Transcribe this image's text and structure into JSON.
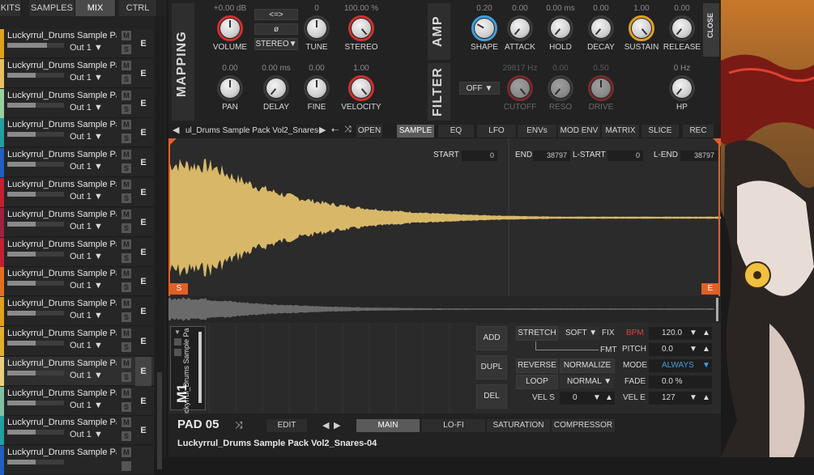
{
  "top_tabs": [
    "KITS",
    "SAMPLES",
    "MIX",
    "CTRL"
  ],
  "active_top_tab": "MIX",
  "pads": [
    {
      "name": "Luckyrrul_Drums Sample Pa...",
      "out": "Out 1 ▼",
      "color": "#e0a020",
      "level": 0.7,
      "mute": "M",
      "solo": "S",
      "edit": "E"
    },
    {
      "name": "Luckyrrul_Drums Sample Pa...",
      "out": "Out 1 ▼",
      "color": "#e8c060",
      "level": 0.5,
      "mute": "M",
      "solo": "S",
      "edit": "E"
    },
    {
      "name": "Luckyrrul_Drums Sample Pa...",
      "out": "Out 1 ▼",
      "color": "#9ad0a0",
      "level": 0.5,
      "mute": "M",
      "solo": "S",
      "edit": "E"
    },
    {
      "name": "Luckyrrul_Drums Sample Pa...",
      "out": "Out 1 ▼",
      "color": "#20a0a0",
      "level": 0.5,
      "mute": "M",
      "solo": "S",
      "edit": "E"
    },
    {
      "name": "Luckyrrul_Drums Sample Pa...",
      "out": "Out 1 ▼",
      "color": "#2060c0",
      "level": 0.5,
      "mute": "M",
      "solo": "S",
      "edit": "E"
    },
    {
      "name": "Luckyrrul_Drums Sample Pa...",
      "out": "Out 1 ▼",
      "color": "#c02030",
      "level": 0.5,
      "mute": "M",
      "solo": "S",
      "edit": "E"
    },
    {
      "name": "Luckyrrul_Drums Sample Pa...",
      "out": "Out 1 ▼",
      "color": "#a02040",
      "level": 0.5,
      "mute": "M",
      "solo": "S",
      "edit": "E"
    },
    {
      "name": "Luckyrrul_Drums Sample Pa...",
      "out": "Out 1 ▼",
      "color": "#c02030",
      "level": 0.5,
      "mute": "M",
      "solo": "S",
      "edit": "E"
    },
    {
      "name": "Luckyrrul_Drums Sample Pa...",
      "out": "Out 1 ▼",
      "color": "#e07020",
      "level": 0.5,
      "mute": "M",
      "solo": "S",
      "edit": "E"
    },
    {
      "name": "Luckyrrul_Drums Sample Pa...",
      "out": "Out 1 ▼",
      "color": "#e0a020",
      "level": 0.5,
      "mute": "M",
      "solo": "S",
      "edit": "E"
    },
    {
      "name": "Luckyrrul_Drums Sample Pa...",
      "out": "Out 1 ▼",
      "color": "#e0b030",
      "level": 0.5,
      "mute": "M",
      "solo": "S",
      "edit": "E"
    },
    {
      "name": "Luckyrrul_Drums Sample Pa...",
      "out": "Out 1 ▼",
      "color": "#e8d080",
      "level": 0.5,
      "mute": "M",
      "solo": "S",
      "edit": "E"
    },
    {
      "name": "Luckyrrul_Drums Sample Pa...",
      "out": "Out 1 ▼",
      "color": "#80c0a0",
      "level": 0.5,
      "mute": "M",
      "solo": "S",
      "edit": "E"
    },
    {
      "name": "Luckyrrul_Drums Sample Pa...",
      "out": "Out 1 ▼",
      "color": "#20a0a0",
      "level": 0.5,
      "mute": "M",
      "solo": "S",
      "edit": "E"
    },
    {
      "name": "Luckyrrul_Drums Sample Pa...",
      "out": "",
      "color": "#2060c0",
      "level": 0.5,
      "mute": "M",
      "solo": "",
      "edit": ""
    }
  ],
  "active_pad_index": 11,
  "mapping": {
    "title": "MAPPING",
    "volume": {
      "label": "VOLUME",
      "value": "+0.00 dB"
    },
    "tune": {
      "label": "TUNE",
      "value": "0"
    },
    "stereo": {
      "label": "STEREO",
      "value": "100.00 %"
    },
    "pan": {
      "label": "PAN",
      "value": "0.00"
    },
    "delay": {
      "label": "DELAY",
      "value": "0.00 ms"
    },
    "fine": {
      "label": "FINE",
      "value": "0.00"
    },
    "velocity": {
      "label": "VELOCITY",
      "value": "1.00"
    },
    "link_btn": "<=>",
    "phase_btn": "ø",
    "stereo_mode": "STEREO▼"
  },
  "amp": {
    "title": "AMP",
    "shape": {
      "label": "SHAPE",
      "value": "0.20"
    },
    "attack": {
      "label": "ATTACK",
      "value": "0.00"
    },
    "hold": {
      "label": "HOLD",
      "value": "0.00 ms"
    },
    "decay": {
      "label": "DECAY",
      "value": "0.00"
    },
    "sustain": {
      "label": "SUSTAIN",
      "value": "1.00"
    },
    "release": {
      "label": "RELEASE",
      "value": "0.00"
    },
    "close": "CLOSE"
  },
  "filter": {
    "title": "FILTER",
    "mode": "OFF",
    "cutoff": {
      "label": "CUTOFF",
      "value": "29817 Hz"
    },
    "reso": {
      "label": "RESO",
      "value": "0.00"
    },
    "drive": {
      "label": "DRIVE",
      "value": "0.50"
    },
    "hp": {
      "label": "HP",
      "value": "0 Hz"
    }
  },
  "sample_nav": {
    "name": "ul_Drums Sample Pack Vol2_Snares-",
    "open": "OPEN"
  },
  "editor_tabs": [
    "SAMPLE",
    "EQ",
    "LFO",
    "ENVs",
    "MOD ENV",
    "MATRIX",
    "SLICE",
    "REC"
  ],
  "active_editor_tab": "SAMPLE",
  "positions": {
    "start_label": "START",
    "start": "0",
    "end_label": "END",
    "end": "38797",
    "lstart_label": "L-START",
    "lstart": "0",
    "lend_label": "L-END",
    "lend": "38797",
    "s_marker": "S",
    "e_marker": "E"
  },
  "layer": {
    "label": "M1",
    "sample": "Luckyrrul_Drums Sample Pa"
  },
  "layer_buttons": [
    "ADD",
    "DUPL",
    "DEL"
  ],
  "sample_opts": {
    "stretch": "STRETCH",
    "stretch_mode": "SOFT ▼",
    "fix": "FIX",
    "fmt": "FMT",
    "bpm_label": "BPM",
    "bpm": "120.0",
    "pitch_label": "PITCH",
    "pitch": "0.0",
    "reverse": "REVERSE",
    "normalize": "NORMALIZE",
    "mode_label": "MODE",
    "mode": "ALWAYS",
    "loop": "LOOP",
    "loop_mode": "NORMAL ▼",
    "fade_label": "FADE",
    "fade": "0.0 %",
    "vels_label": "VEL S",
    "vels": "0",
    "vele_label": "VEL E",
    "vele": "127",
    "bpm_color": "#e04040",
    "mode_color": "#40a0e0"
  },
  "bottom": {
    "pad_label": "PAD 05",
    "edit": "EDIT",
    "tabs": [
      "MAIN",
      "LO-FI",
      "SATURATION",
      "COMPRESSOR"
    ],
    "active_tab": "MAIN",
    "sample_name": "Luckyrrul_Drums Sample Pack Vol2_Snares-04"
  },
  "colors": {
    "waveform": "#d8b868",
    "overview": "#6a6a6a",
    "marker": "#e0602a",
    "sustain_ring": "#e0a020",
    "shape_ring": "#40a0e0",
    "red_ring": "#d03030"
  }
}
